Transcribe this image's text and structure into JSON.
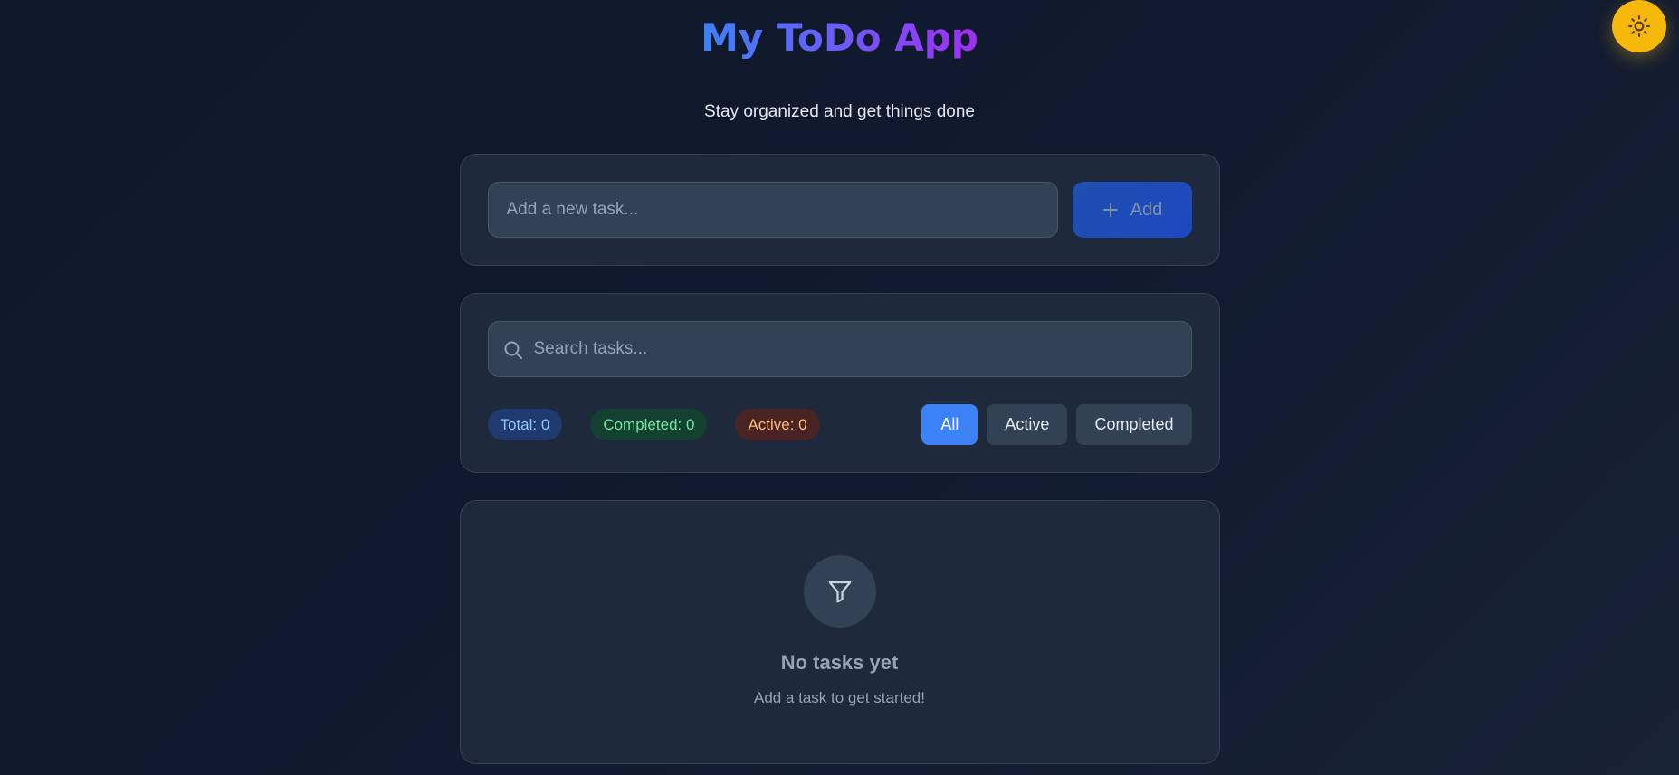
{
  "header": {
    "title": "My ToDo App",
    "subtitle": "Stay organized and get things done"
  },
  "theme_toggle": {
    "icon": "sun-icon",
    "color": "#f5b80b"
  },
  "add_task": {
    "placeholder": "Add a new task...",
    "value": "",
    "button_label": "Add",
    "button_icon": "plus-icon"
  },
  "search": {
    "placeholder": "Search tasks...",
    "value": "",
    "icon": "search-icon"
  },
  "stats": {
    "total": "Total: 0",
    "completed": "Completed: 0",
    "active": "Active: 0"
  },
  "filters": {
    "all": "All",
    "active": "Active",
    "completed": "Completed",
    "selected": "All"
  },
  "empty_state": {
    "icon": "filter-icon",
    "title": "No tasks yet",
    "subtitle": "Add a task to get started!"
  },
  "colors": {
    "accent": "#3b82f6",
    "title_gradient_start": "#3b82f6",
    "title_gradient_end": "#a32cf0",
    "background": "#0f172a",
    "card": "#1e293b"
  }
}
